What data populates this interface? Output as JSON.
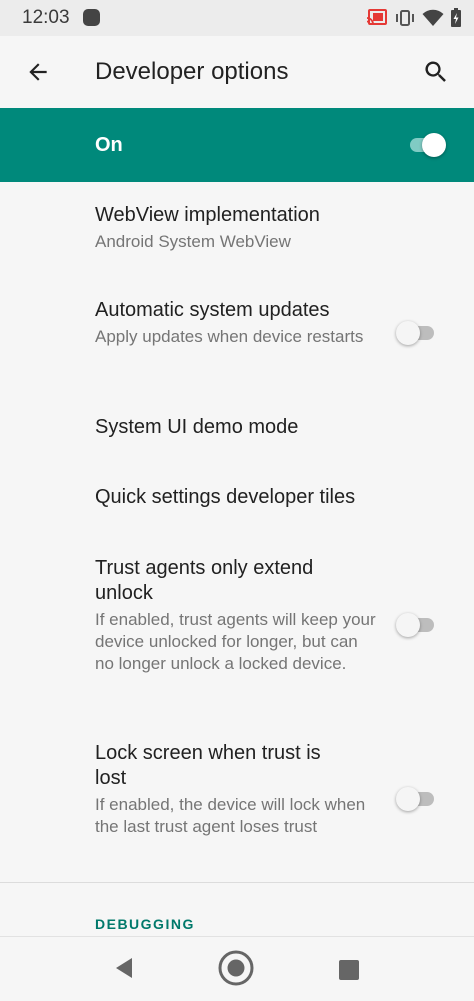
{
  "status_bar": {
    "time": "12:03",
    "icons": [
      "app-notification-icon",
      "cast-icon",
      "vibrate-icon",
      "wifi-icon",
      "battery-charging-icon"
    ],
    "cast_color": "#e53935"
  },
  "header": {
    "title": "Developer options",
    "back_icon": "arrow-left-icon",
    "search_icon": "search-icon"
  },
  "master": {
    "label": "On",
    "enabled": true,
    "background": "#00897b"
  },
  "preferences": [
    {
      "title": "WebView implementation",
      "summary": "Android System WebView"
    },
    {
      "title": "Automatic system updates",
      "summary": "Apply updates when device restarts",
      "toggle": false
    },
    {
      "title": "System UI demo mode",
      "summary": ""
    },
    {
      "title": "Quick settings developer tiles",
      "summary": ""
    },
    {
      "title": "Trust agents only extend unlock",
      "summary": "If enabled, trust agents will keep your device unlocked for longer, but can no longer unlock a locked device.",
      "toggle": false
    },
    {
      "title": "Lock screen when trust is lost",
      "summary": "If enabled, the device will lock when the last trust agent loses trust",
      "toggle": false
    }
  ],
  "category": {
    "debugging_label": "DEBUGGING"
  },
  "nav_bar": {
    "icons": [
      "nav-back-icon",
      "nav-home-icon",
      "nav-recents-icon"
    ]
  }
}
